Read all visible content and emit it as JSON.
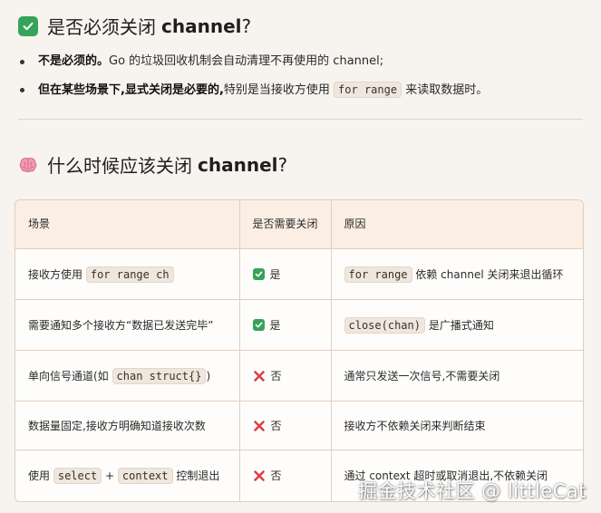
{
  "section1": {
    "title_cn": "是否必须关闭",
    "title_en": "channel",
    "title_q": "?",
    "icon": "check-mark-button-icon",
    "bullets": [
      {
        "bold": "不是必须的。",
        "text": "Go 的垃圾回收机制会自动清理不再使用的 channel;"
      },
      {
        "bold": "但在某些场景下,显式关闭是必要的,",
        "text": "特别是当接收方使用",
        "code": "for range",
        "text2": "来读取数据时。"
      }
    ]
  },
  "section2": {
    "title_cn": "什么时候应该关闭",
    "title_en": "channel",
    "title_q": "?",
    "icon": "brain-icon"
  },
  "table": {
    "headers": [
      "场景",
      "是否需要关闭",
      "原因"
    ],
    "rows": [
      {
        "scene_pre": "接收方使用",
        "scene_code": "for range ch",
        "scene_post": "",
        "needs": "是",
        "needs_icon": "check-icon",
        "reason_code": "for range",
        "reason": "依赖 channel 关闭来退出循环"
      },
      {
        "scene_pre": "需要通知多个接收方“数据已发送完毕”",
        "scene_code": "",
        "scene_post": "",
        "needs": "是",
        "needs_icon": "check-icon",
        "reason_code": "close(chan)",
        "reason": "是广播式通知"
      },
      {
        "scene_pre": "单向信号通道(如",
        "scene_code": "chan struct{}",
        "scene_post": ")",
        "needs": "否",
        "needs_icon": "cross-icon",
        "reason_code": "",
        "reason": "通常只发送一次信号,不需要关闭"
      },
      {
        "scene_pre": "数据量固定,接收方明确知道接收次数",
        "scene_code": "",
        "scene_post": "",
        "needs": "否",
        "needs_icon": "cross-icon",
        "reason_code": "",
        "reason": "接收方不依赖关闭来判断结束"
      },
      {
        "scene_pre": "使用",
        "scene_code": "select",
        "scene_mid": "+",
        "scene_code2": "context",
        "scene_post": "控制退出",
        "needs": "否",
        "needs_icon": "cross-icon",
        "reason_code": "",
        "reason": "通过 context 超时或取消退出,不依赖关闭"
      }
    ]
  },
  "watermark": "掘金技术社区 @ littleCat",
  "colors": {
    "check_green": "#36a35a",
    "cross_red": "#d9404a",
    "header_bg": "#fbeee4",
    "border": "#e3cdbb",
    "page_bg": "#f7f4ef"
  }
}
